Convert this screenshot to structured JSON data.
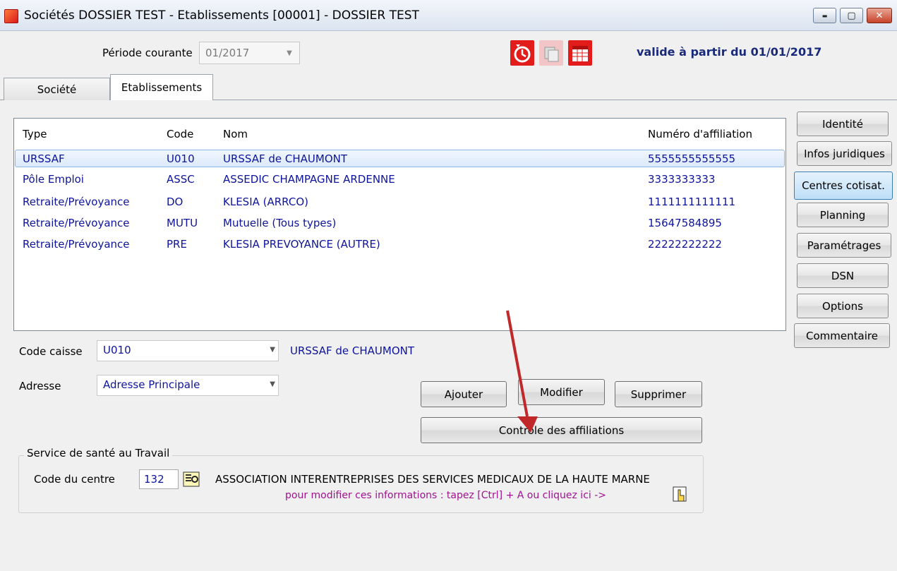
{
  "window": {
    "title": "Sociétés DOSSIER TEST - Etablissements [00001] - DOSSIER TEST",
    "minimize": "▬",
    "maximize": "▢",
    "close": "✕"
  },
  "toolbar": {
    "period_label": "Période courante",
    "period_value": "01/2017",
    "valid_text": "valide à partir du 01/01/2017",
    "icons": [
      "clock-refresh-icon",
      "copy-icon",
      "calendar-icon"
    ]
  },
  "tabs": [
    {
      "label": "Société",
      "active": false
    },
    {
      "label": "Etablissements",
      "active": true
    }
  ],
  "table": {
    "headers": [
      "Type",
      "Code",
      "Nom",
      "Numéro d'affiliation"
    ],
    "rows": [
      {
        "type": "URSSAF",
        "code": "U010",
        "nom": "URSSAF de CHAUMONT",
        "numero": "5555555555555",
        "selected": true
      },
      {
        "type": "Pôle Emploi",
        "code": "ASSC",
        "nom": "ASSEDIC CHAMPAGNE ARDENNE",
        "numero": "3333333333",
        "selected": false
      },
      {
        "type": "Retraite/Prévoyance",
        "code": "DO",
        "nom": "KLESIA (ARRCO)",
        "numero": "1111111111111",
        "selected": false
      },
      {
        "type": "Retraite/Prévoyance",
        "code": "MUTU",
        "nom": "Mutuelle (Tous types)",
        "numero": "15647584895",
        "selected": false
      },
      {
        "type": "Retraite/Prévoyance",
        "code": "PRE",
        "nom": "KLESIA PREVOYANCE (AUTRE)",
        "numero": "22222222222",
        "selected": false
      }
    ]
  },
  "form": {
    "code_caisse_label": "Code caisse",
    "code_caisse_value": "U010",
    "code_caisse_name": "URSSAF de CHAUMONT",
    "adresse_label": "Adresse",
    "adresse_value": "Adresse Principale"
  },
  "buttons": {
    "ajouter": "Ajouter",
    "modifier": "Modifier",
    "supprimer": "Supprimer",
    "controle": "Contrôle des affiliations"
  },
  "side_buttons": [
    {
      "label": "Identité",
      "active": false
    },
    {
      "label": "Infos juridiques",
      "active": false
    },
    {
      "label": "Centres cotisat.",
      "active": true
    },
    {
      "label": "Planning",
      "active": false
    },
    {
      "label": "Paramétrages",
      "active": false
    },
    {
      "label": "DSN",
      "active": false
    },
    {
      "label": "Options",
      "active": false
    },
    {
      "label": "Commentaire",
      "active": false
    }
  ],
  "sante_travail": {
    "title": "Service de santé au Travail",
    "code_label": "Code du centre",
    "code_value": "132",
    "association": "ASSOCIATION INTERENTREPRISES DES SERVICES MEDICAUX DE LA HAUTE MARNE",
    "hint": "pour modifier ces informations : tapez [Ctrl] + A ou cliquez ici ->"
  },
  "colors": {
    "link_blue": "#0e149a",
    "hint_magenta": "#a0138f",
    "arrow_red": "#c0282a"
  }
}
